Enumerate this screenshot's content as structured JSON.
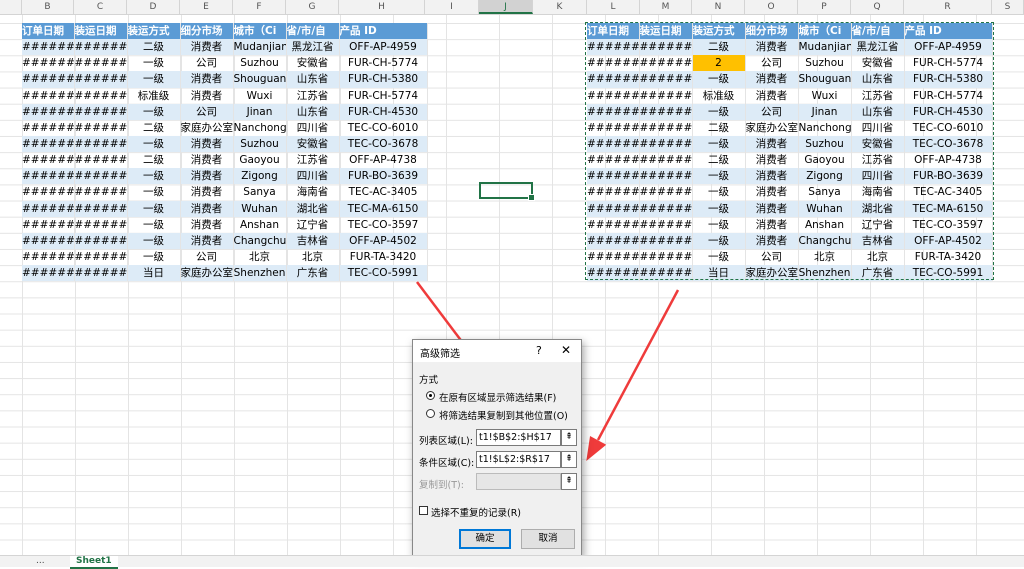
{
  "columns": [
    "B",
    "C",
    "D",
    "E",
    "F",
    "G",
    "H",
    "I",
    "J",
    "K",
    "L",
    "M",
    "N",
    "O",
    "P",
    "Q",
    "R",
    "S"
  ],
  "selected_column": "J",
  "headers": [
    "订单日期",
    "装运日期",
    "装运方式",
    "细分市场",
    "城市（Ci",
    "省/市/自",
    "产品 ID"
  ],
  "left_rows": [
    [
      "######",
      "######",
      "二级",
      "消费者",
      "Mudanjiang",
      "黑龙江省",
      "OFF-AP-4959"
    ],
    [
      "######",
      "######",
      "一级",
      "公司",
      "Suzhou",
      "安徽省",
      "FUR-CH-5774"
    ],
    [
      "######",
      "######",
      "一级",
      "消费者",
      "Shouguang",
      "山东省",
      "FUR-CH-5380"
    ],
    [
      "######",
      "######",
      "标准级",
      "消费者",
      "Wuxi",
      "江苏省",
      "FUR-CH-5774"
    ],
    [
      "######",
      "######",
      "一级",
      "公司",
      "Jinan",
      "山东省",
      "FUR-CH-4530"
    ],
    [
      "######",
      "######",
      "二级",
      "家庭办公室",
      "Nanchong",
      "四川省",
      "TEC-CO-6010"
    ],
    [
      "######",
      "######",
      "一级",
      "消费者",
      "Suzhou",
      "安徽省",
      "TEC-CO-3678"
    ],
    [
      "######",
      "######",
      "二级",
      "消费者",
      "Gaoyou",
      "江苏省",
      "OFF-AP-4738"
    ],
    [
      "######",
      "######",
      "一级",
      "消费者",
      "Zigong",
      "四川省",
      "FUR-BO-3639"
    ],
    [
      "######",
      "######",
      "一级",
      "消费者",
      "Sanya",
      "海南省",
      "TEC-AC-3405"
    ],
    [
      "######",
      "######",
      "一级",
      "消费者",
      "Wuhan",
      "湖北省",
      "TEC-MA-6150"
    ],
    [
      "######",
      "######",
      "一级",
      "消费者",
      "Anshan",
      "辽宁省",
      "TEC-CO-3597"
    ],
    [
      "######",
      "######",
      "一级",
      "消费者",
      "Changchun",
      "吉林省",
      "OFF-AP-4502"
    ],
    [
      "######",
      "######",
      "一级",
      "公司",
      "北京",
      "北京",
      "FUR-TA-3420"
    ],
    [
      "######",
      "######",
      "当日",
      "家庭办公室",
      "Shenzhen",
      "广东省",
      "TEC-CO-5991"
    ]
  ],
  "right_rows": [
    [
      "######",
      "######",
      "二级",
      "消费者",
      "Mudanjiang",
      "黑龙江省",
      "OFF-AP-4959"
    ],
    [
      "######",
      "######",
      "2",
      "公司",
      "Suzhou",
      "安徽省",
      "FUR-CH-5774"
    ],
    [
      "######",
      "######",
      "一级",
      "消费者",
      "Shouguang",
      "山东省",
      "FUR-CH-5380"
    ],
    [
      "######",
      "######",
      "标准级",
      "消费者",
      "Wuxi",
      "江苏省",
      "FUR-CH-5774"
    ],
    [
      "######",
      "######",
      "一级",
      "公司",
      "Jinan",
      "山东省",
      "FUR-CH-4530"
    ],
    [
      "######",
      "######",
      "二级",
      "家庭办公室",
      "Nanchong",
      "四川省",
      "TEC-CO-6010"
    ],
    [
      "######",
      "######",
      "一级",
      "消费者",
      "Suzhou",
      "安徽省",
      "TEC-CO-3678"
    ],
    [
      "######",
      "######",
      "二级",
      "消费者",
      "Gaoyou",
      "江苏省",
      "OFF-AP-4738"
    ],
    [
      "######",
      "######",
      "一级",
      "消费者",
      "Zigong",
      "四川省",
      "FUR-BO-3639"
    ],
    [
      "######",
      "######",
      "一级",
      "消费者",
      "Sanya",
      "海南省",
      "TEC-AC-3405"
    ],
    [
      "######",
      "######",
      "一级",
      "消费者",
      "Wuhan",
      "湖北省",
      "TEC-MA-6150"
    ],
    [
      "######",
      "######",
      "一级",
      "消费者",
      "Anshan",
      "辽宁省",
      "TEC-CO-3597"
    ],
    [
      "######",
      "######",
      "一级",
      "消费者",
      "Changchun",
      "吉林省",
      "OFF-AP-4502"
    ],
    [
      "######",
      "######",
      "一级",
      "公司",
      "北京",
      "北京",
      "FUR-TA-3420"
    ],
    [
      "######",
      "######",
      "当日",
      "家庭办公室",
      "Shenzhen",
      "广东省",
      "TEC-CO-5991"
    ]
  ],
  "highlight_cell": {
    "row": 1,
    "col": 2,
    "color": "#ffc000"
  },
  "colors": {
    "header_bg": "#5b9bd5",
    "band_bg": "#ddebf7",
    "excel_green": "#217346",
    "arrow": "#ef3b3b"
  },
  "sheet_tabs": [
    "...",
    "Sheet1"
  ],
  "active_tab": "Sheet1",
  "dialog": {
    "title": "高级筛选",
    "help_glyph": "?",
    "close_glyph": "✕",
    "mode_label": "方式",
    "option_in_place": "在原有区域显示筛选结果(F)",
    "option_copy": "将筛选结果复制到其他位置(O)",
    "selected_option": "in_place",
    "list_range_label": "列表区域(L):",
    "list_range_value": "t1!$B$2:$H$17",
    "criteria_range_label": "条件区域(C):",
    "criteria_range_value": "t1!$L$2:$R$17",
    "copy_to_label": "复制到(T):",
    "copy_to_value": "",
    "unique_label": "选择不重复的记录(R)",
    "unique_checked": false,
    "ok_label": "确定",
    "cancel_label": "取消",
    "picker_glyph": "⇞"
  }
}
